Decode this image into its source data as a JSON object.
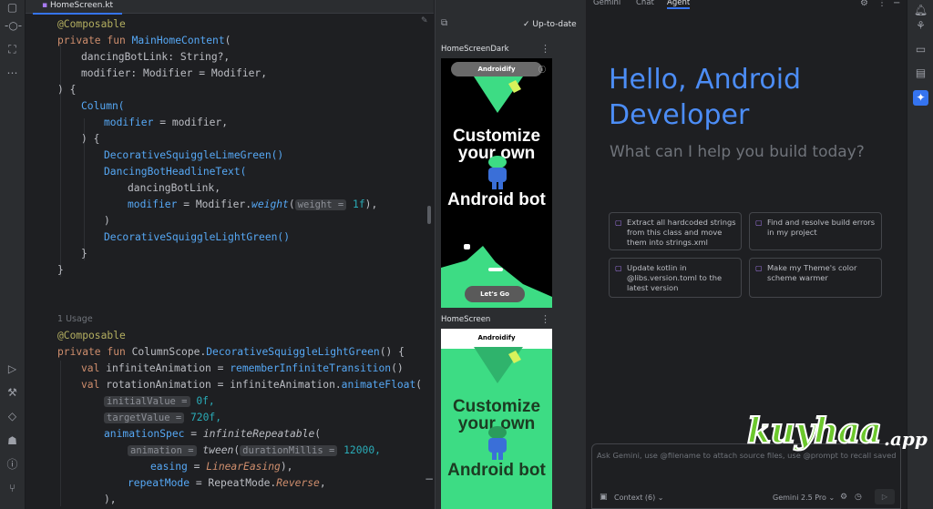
{
  "editor": {
    "tab_label": "HomeScreen.kt",
    "usage_hint": "1 Usage",
    "lines": {
      "l1": "@Composable",
      "l2a": "private fun ",
      "l2b": "MainHomeContent",
      "l2c": "(",
      "l3": "dancingBotLink: String?,",
      "l4": "modifier: Modifier = Modifier,",
      "l5": ") {",
      "l6": "Column(",
      "l7a": "modifier",
      "l7b": " = modifier,",
      "l8": ") {",
      "l9": "DecorativeSquiggleLimeGreen()",
      "l10": "DancingBotHeadlineText(",
      "l11": "dancingBotLink,",
      "l12a": "modifier",
      "l12b": " = Modifier.",
      "l12c": "weight",
      "l12d": "(",
      "l12hint": "weight =",
      "l12e": " 1f",
      "l12f": "),",
      "l13": ")",
      "l14": "DecorativeSquiggleLightGreen()",
      "l15": "}",
      "l16": "}",
      "l17": "@Composable",
      "l18a": "private fun ",
      "l18b": "ColumnScope.",
      "l18c": "DecorativeSquiggleLightGreen",
      "l18d": "() {",
      "l19a": "val ",
      "l19b": "infiniteAnimation",
      "l19c": " = ",
      "l19d": "rememberInfiniteTransition",
      "l19e": "()",
      "l20a": "val ",
      "l20b": "rotationAnimation",
      "l20c": " = infiniteAnimation.",
      "l20d": "animateFloat",
      "l20e": "(",
      "l21hint": "initialValue =",
      "l21v": " 0f,",
      "l22hint": "targetValue =",
      "l22v": " 720f,",
      "l23a": "animationSpec",
      "l23b": " = ",
      "l23c": "infiniteRepeatable",
      "l23d": "(",
      "l24hint": "animation =",
      "l24a": " tween",
      "l24b": "(",
      "l24hint2": "durationMillis =",
      "l24v": " 12000,",
      "l25a": "easing",
      "l25b": " = ",
      "l25c": "LinearEasing",
      "l25d": "),",
      "l26a": "repeatMode",
      "l26b": " = RepeatMode.",
      "l26c": "Reverse",
      "l26d": ",",
      "l27": "),"
    }
  },
  "preview": {
    "status": "Up-to-date",
    "more": "⋮",
    "dark": {
      "title": "HomeScreenDark",
      "app_name": "Androidify",
      "line1": "Customize",
      "line2": "your own",
      "line3": "Android bot",
      "cta": "Let's Go"
    },
    "light": {
      "title": "HomeScreen",
      "app_name": "Androidify",
      "line1": "Customize",
      "line2": "your own",
      "line3": "Android bot"
    }
  },
  "gemini": {
    "tabs": [
      "Gemini",
      "Chat",
      "Agent"
    ],
    "hello_line1": "Hello, Android",
    "hello_line2": "Developer",
    "subtitle": "What can I help you build today?",
    "suggestions": [
      "Extract all hardcoded strings from this class and move them into strings.xml",
      "Find and resolve build errors in my project",
      "Update kotlin in @libs.version.toml to the latest version",
      "Make my Theme's color scheme warmer"
    ],
    "placeholder": "Ask Gemini, use @filename to attach source files, use @prompt to recall saved pr",
    "context_label": "Context (6)",
    "model_label": "Gemini 2.5 Pro"
  },
  "watermark": {
    "text": "kuyhaa",
    "tld": ".app"
  },
  "colors": {
    "editor_bg": "#1e1f22",
    "accent": "#3574f0",
    "gemini_blue": "#4c8df6",
    "android_green": "#3ddc84"
  }
}
